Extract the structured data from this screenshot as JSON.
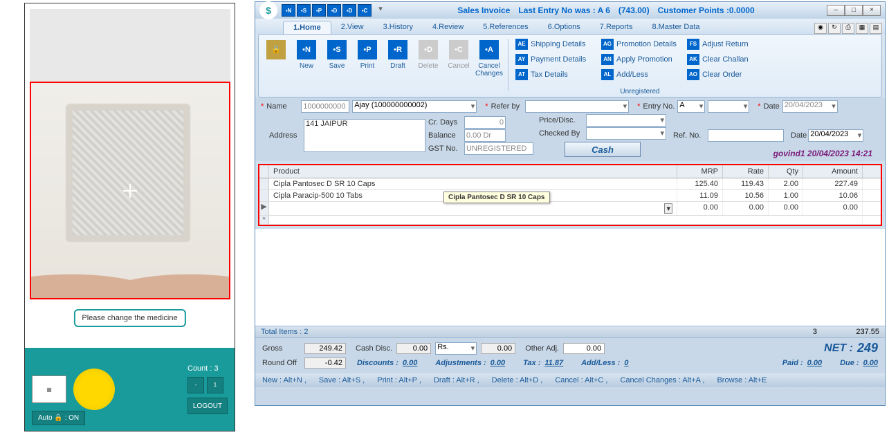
{
  "left": {
    "message": "Please change the medicine",
    "count_label": "Count : 3",
    "auto_label": "Auto 🔒 : ON",
    "logout_label": "LOGOUT"
  },
  "title": {
    "app": "Sales Invoice",
    "last_entry": "Last Entry No was : A 6",
    "amount": "(743.00)",
    "points": "Customer Points :0.0000"
  },
  "qat": [
    "▪N",
    "▪S",
    "▪P",
    "▪D",
    "▪D",
    "▪C"
  ],
  "tabs": [
    {
      "label": "1.Home",
      "active": true
    },
    {
      "label": "2.View"
    },
    {
      "label": "3.History"
    },
    {
      "label": "4.Review"
    },
    {
      "label": "5.References"
    },
    {
      "label": "6.Options"
    },
    {
      "label": "7.Reports"
    },
    {
      "label": "8.Master Data"
    }
  ],
  "ribbon": {
    "main": [
      {
        "ico": "🔒",
        "lbl": "",
        "lock": true
      },
      {
        "ico": "▪N",
        "lbl": "New"
      },
      {
        "ico": "▪S",
        "lbl": "Save"
      },
      {
        "ico": "▪P",
        "lbl": "Print"
      },
      {
        "ico": "▪R",
        "lbl": "Draft"
      },
      {
        "ico": "▪D",
        "lbl": "Delete",
        "disabled": true
      },
      {
        "ico": "▪C",
        "lbl": "Cancel",
        "disabled": true
      },
      {
        "ico": "▪A",
        "lbl": "Cancel Changes"
      }
    ],
    "col1": [
      {
        "ico": "AE",
        "lbl": "Shipping Details"
      },
      {
        "ico": "AY",
        "lbl": "Payment Details"
      },
      {
        "ico": "AT",
        "lbl": "Tax Details"
      }
    ],
    "col2": [
      {
        "ico": "AG",
        "lbl": "Promotion Details"
      },
      {
        "ico": "AN",
        "lbl": "Apply Promotion"
      },
      {
        "ico": "AL",
        "lbl": "Add/Less"
      }
    ],
    "col3": [
      {
        "ico": "FS",
        "lbl": "Adjust Return"
      },
      {
        "ico": "AK",
        "lbl": "Clear Challan"
      },
      {
        "ico": "AO",
        "lbl": "Clear Order"
      }
    ],
    "group_label": "Unregistered"
  },
  "form": {
    "name_lbl": "Name",
    "name_code": "1000000000",
    "name_combo": "Ajay (100000000002)",
    "address_lbl": "Address",
    "address": "141 JAIPUR",
    "crdays_lbl": "Cr. Days",
    "crdays": "0",
    "balance_lbl": "Balance",
    "balance": "0.00 Dr",
    "gst_lbl": "GST No.",
    "gst": "UNREGISTERED",
    "refer_lbl": "Refer by",
    "price_lbl": "Price/Disc.",
    "checked_lbl": "Checked By",
    "cash_btn": "Cash",
    "entry_lbl": "Entry No.",
    "entry": "A",
    "ref_lbl": "Ref. No.",
    "date_lbl": "Date",
    "date1": "20/04/2023",
    "date2": "20/04/2023",
    "stamp": "govind1 20/04/2023 14:21"
  },
  "grid": {
    "headers": [
      "Product",
      "MRP",
      "Rate",
      "Qty",
      "Amount"
    ],
    "rows": [
      {
        "product": "Cipla Pantosec D SR 10 Caps",
        "mrp": "125.40",
        "rate": "119.43",
        "qty": "2.00",
        "amount": "227.49"
      },
      {
        "product": "Cipla Paracip-500 10 Tabs",
        "mrp": "11.09",
        "rate": "10.56",
        "qty": "1.00",
        "amount": "10.06"
      },
      {
        "product": "",
        "mrp": "0.00",
        "rate": "0.00",
        "qty": "0.00",
        "amount": "0.00",
        "active": true
      }
    ],
    "tooltip": "Cipla Pantosec D SR 10 Caps"
  },
  "totals": {
    "lbl": "Total Items : 2",
    "qty": "3",
    "amt": "237.55"
  },
  "summary": {
    "gross_lbl": "Gross",
    "gross": "249.42",
    "cashdisc_lbl": "Cash Disc.",
    "cashdisc": "0.00",
    "rs_lbl": "Rs.",
    "rs": "0.00",
    "otheradj_lbl": "Other Adj.",
    "otheradj": "0.00",
    "net_lbl": "NET :",
    "net": "249",
    "roundoff_lbl": "Round Off",
    "roundoff": "-0.42",
    "discounts_lbl": "Discounts :",
    "discounts": "0.00",
    "adjustments_lbl": "Adjustments :",
    "adjustments": "0.00",
    "tax_lbl": "Tax :",
    "tax": "11.87",
    "addless_lbl": "Add/Less :",
    "addless": "0",
    "paid_lbl": "Paid :",
    "paid": "0.00",
    "due_lbl": "Due :",
    "due": "0.00"
  },
  "shortcuts": [
    "New : Alt+N ,",
    "Save : Alt+S ,",
    "Print : Alt+P ,",
    "Draft : Alt+R ,",
    "Delete : Alt+D ,",
    "Cancel : Alt+C ,",
    "Cancel Changes : Alt+A ,",
    "Browse : Alt+E"
  ]
}
